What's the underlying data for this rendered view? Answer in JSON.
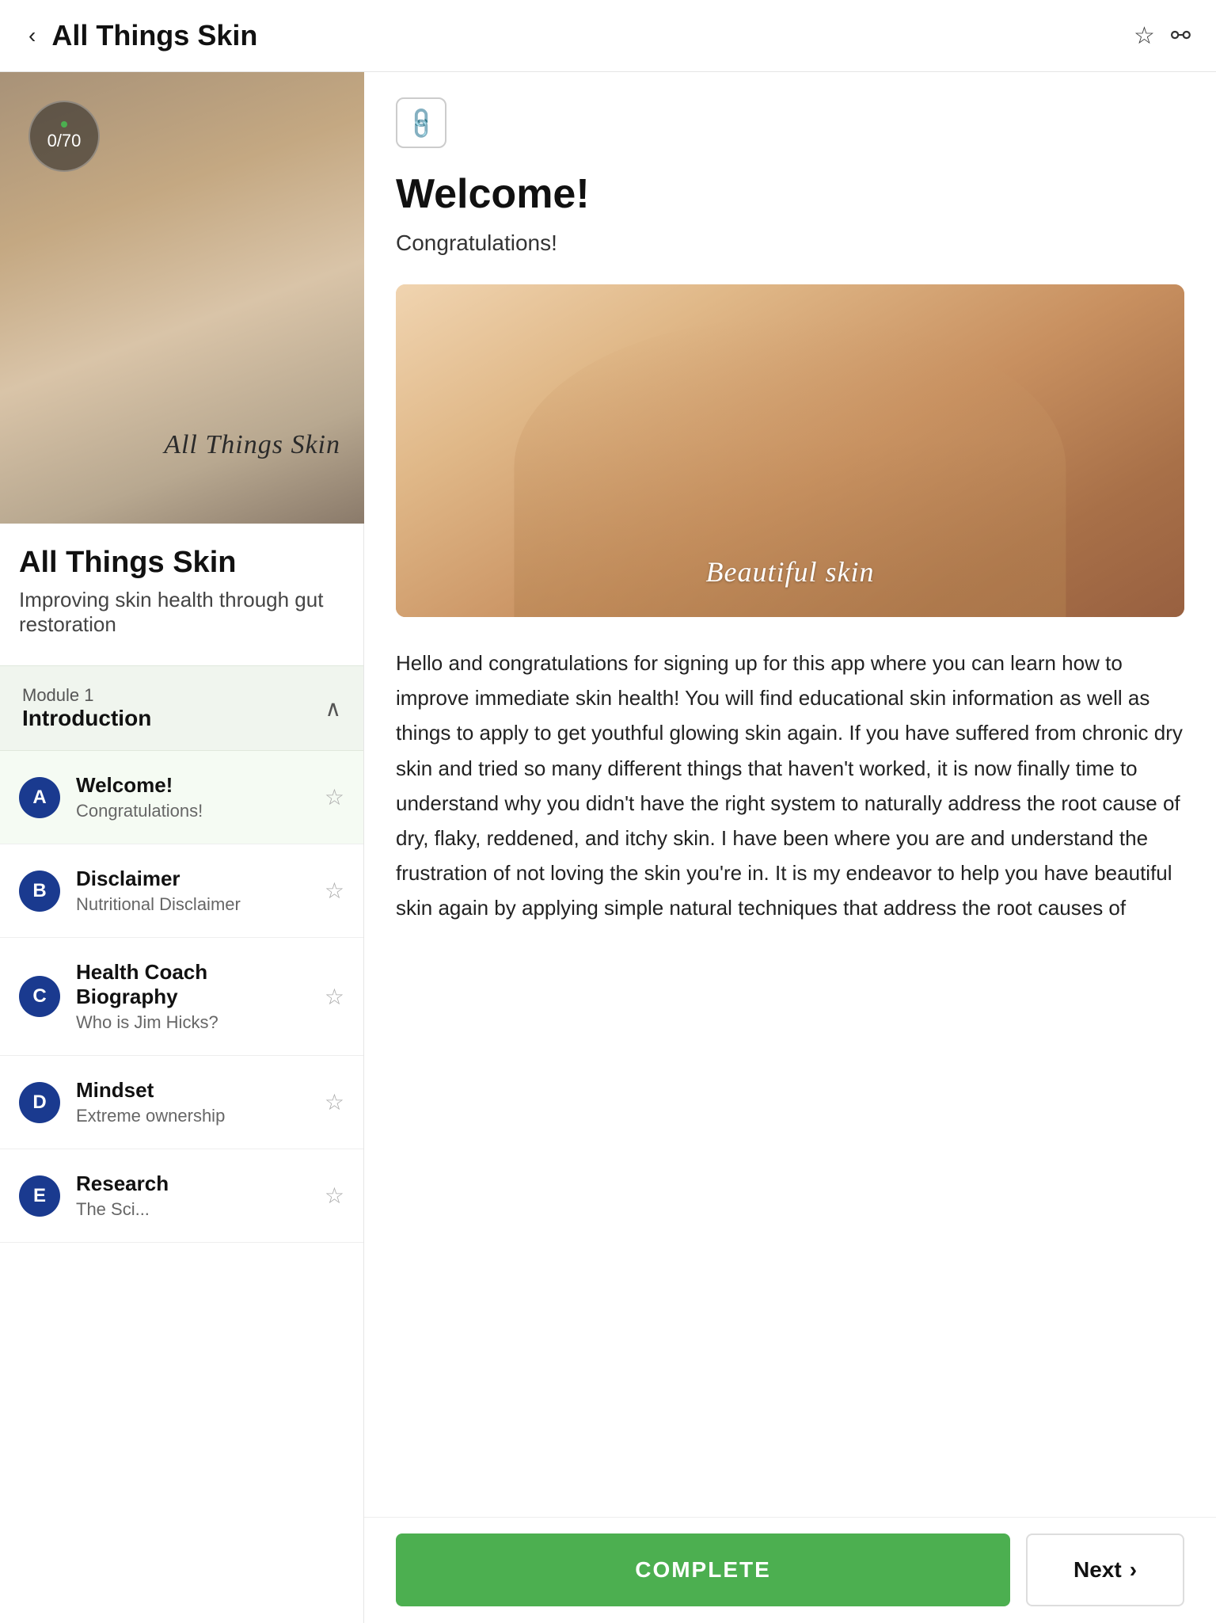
{
  "header": {
    "title": "All Things Skin",
    "back_label": "‹",
    "bookmark_icon": "☆",
    "share_icon": "⚯"
  },
  "left_panel": {
    "course_image_text": "All Things Skin",
    "progress": {
      "current": 0,
      "total": 70,
      "display": "0/70"
    },
    "course_title": "All Things Skin",
    "course_subtitle": "Improving skin health through gut restoration",
    "module": {
      "label": "Module 1",
      "name": "Introduction"
    },
    "lessons": [
      {
        "letter": "A",
        "title": "Welcome!",
        "subtitle": "Congratulations!",
        "active": true
      },
      {
        "letter": "B",
        "title": "Disclaimer",
        "subtitle": "Nutritional Disclaimer",
        "active": false
      },
      {
        "letter": "C",
        "title": "Health Coach Biography",
        "subtitle": "Who is Jim Hicks?",
        "active": false
      },
      {
        "letter": "D",
        "title": "Mindset",
        "subtitle": "Extreme ownership",
        "active": false
      },
      {
        "letter": "E",
        "title": "Research",
        "subtitle": "The Sci...",
        "active": false
      }
    ]
  },
  "right_panel": {
    "link_icon": "🔗",
    "welcome_title": "Welcome!",
    "welcome_subtitle": "Congratulations!",
    "beauty_image_text": "Beautiful skin",
    "description": "Hello and congratulations for signing up for this app where you can learn how to improve immediate skin health! You will find educational skin information as well as things to apply to get youthful glowing skin again. If you have suffered from chronic dry skin and tried so many different things that haven't worked, it is now finally time to understand why you didn't have the right system to naturally address the root cause of dry, flaky, reddened, and itchy skin. I have been where you are and understand the frustration of not loving the skin you're in. It is my endeavor to help you have beautiful skin again by applying simple natural techniques that address the root causes of"
  },
  "bottom_bar": {
    "complete_label": "COMPLETE",
    "next_label": "Next",
    "next_arrow": "›"
  }
}
